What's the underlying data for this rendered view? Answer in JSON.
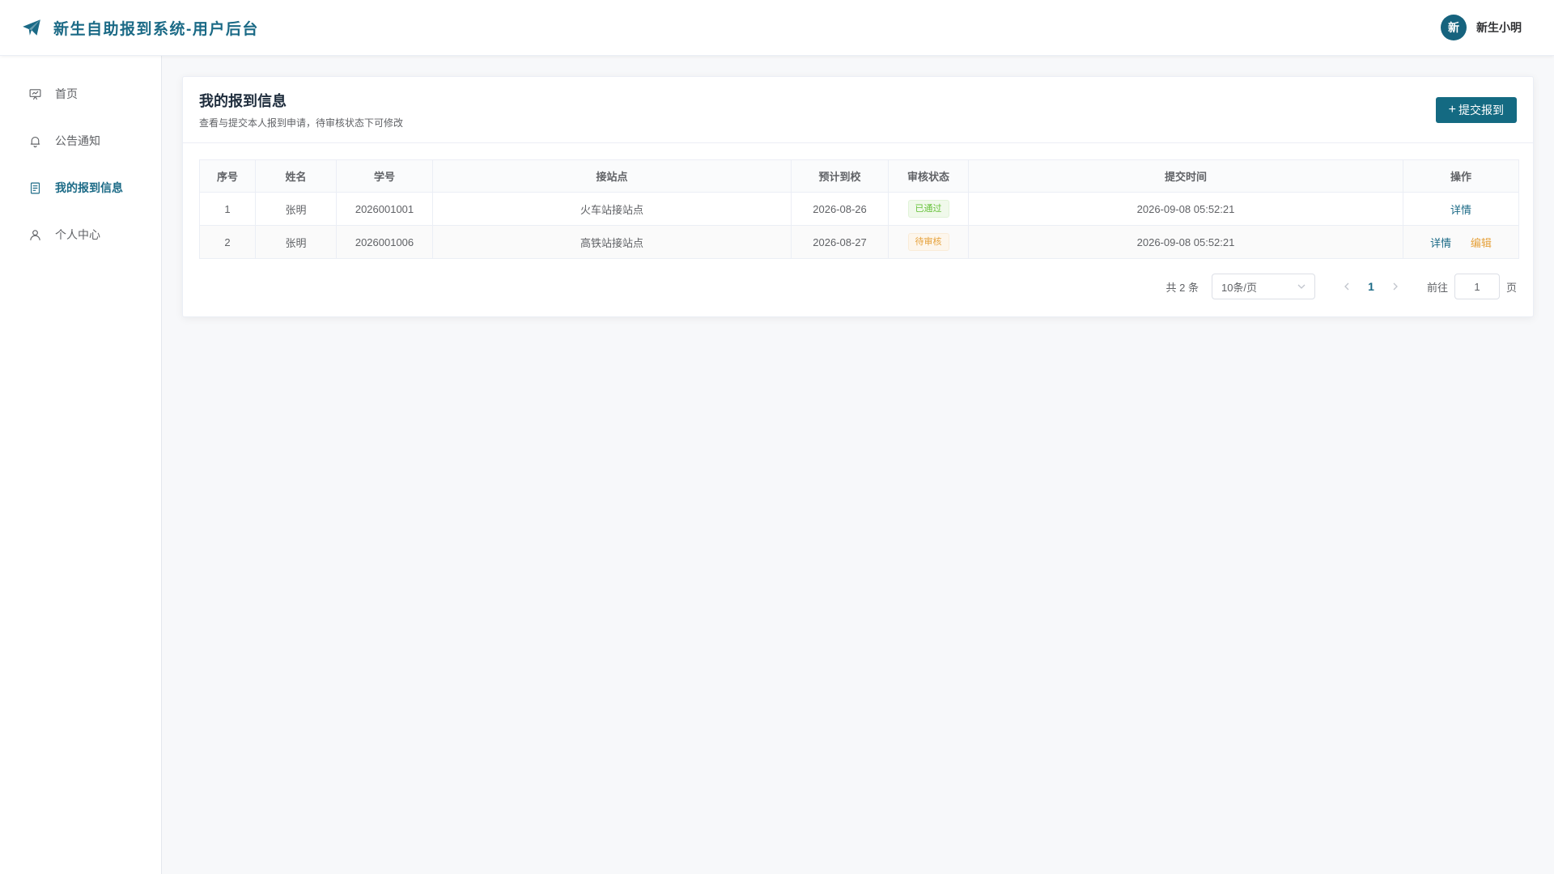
{
  "header": {
    "title": "新生自助报到系统-用户后台",
    "avatar_text": "新",
    "user_name": "新生小明",
    "brand_color": "#1b6a86"
  },
  "sidebar": {
    "items": [
      {
        "label": "首页",
        "icon": "presentation-icon",
        "active": false
      },
      {
        "label": "公告通知",
        "icon": "bell-icon",
        "active": false
      },
      {
        "label": "我的报到信息",
        "icon": "document-icon",
        "active": true
      },
      {
        "label": "个人中心",
        "icon": "user-icon",
        "active": false
      }
    ]
  },
  "card": {
    "title": "我的报到信息",
    "subtitle": "查看与提交本人报到申请，待审核状态下可修改",
    "submit_label": "提交报到"
  },
  "table": {
    "columns": [
      "序号",
      "姓名",
      "学号",
      "接站点",
      "预计到校",
      "审核状态",
      "提交时间",
      "操作"
    ],
    "rows": [
      {
        "index": "1",
        "name": "张明",
        "student_id": "2026001001",
        "station": "火车站接站点",
        "arrival": "2026-08-26",
        "status": "已通过",
        "status_type": "success",
        "submitted": "2026-09-08 05:52:21",
        "actions": [
          "详情"
        ]
      },
      {
        "index": "2",
        "name": "张明",
        "student_id": "2026001006",
        "station": "高铁站接站点",
        "arrival": "2026-08-27",
        "status": "待审核",
        "status_type": "warning",
        "submitted": "2026-09-08 05:52:21",
        "actions": [
          "详情",
          "编辑"
        ]
      }
    ]
  },
  "pagination": {
    "total_text": "共 2 条",
    "page_size": "10条/页",
    "current_page": "1",
    "goto_label": "前往",
    "goto_value": "1",
    "page_suffix": "页"
  }
}
